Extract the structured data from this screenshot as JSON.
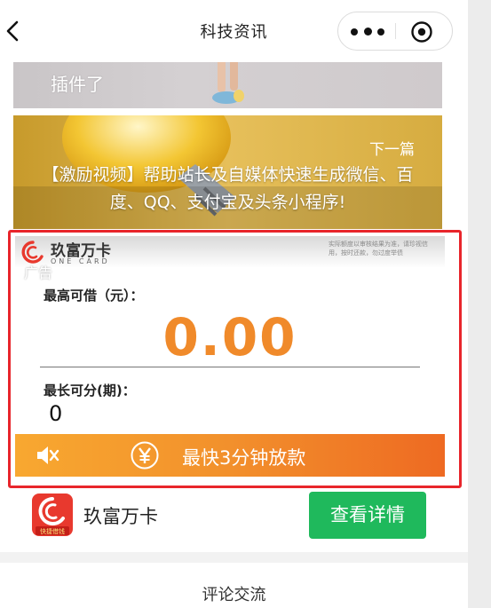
{
  "navbar": {
    "title": "科技资讯"
  },
  "prev_article": {
    "title_tail": "插件了"
  },
  "next_article": {
    "label": "下一篇",
    "title": "【激励视频】帮助站长及自媒体快速生成微信、百度、QQ、支付宝及头条小程序!"
  },
  "ad": {
    "tag": "广告",
    "brand": {
      "name": "玖富万卡",
      "subtitle": "ONE CARD"
    },
    "fine_print": "实际额度以审核结果为准，请珍视信用，按时还款，勿过度举债",
    "max_amount_label": "最高可借（元）：",
    "max_amount": "0.00",
    "max_periods_label": "最长可分(期)：",
    "max_periods": "0",
    "cta": "最快3分钟放款",
    "app_badge": "快捷借钱",
    "app_name": "玖富万卡",
    "detail_button": "查看详情",
    "accent_color": "#f08a2a",
    "frame_color": "#e8252b",
    "button_color": "#1fb95c"
  },
  "comments": {
    "heading": "评论交流"
  },
  "icons": [
    "back-icon",
    "more-icon",
    "close-target-icon",
    "brand-logo-icon",
    "mute-icon",
    "yen-icon",
    "app-icon"
  ]
}
